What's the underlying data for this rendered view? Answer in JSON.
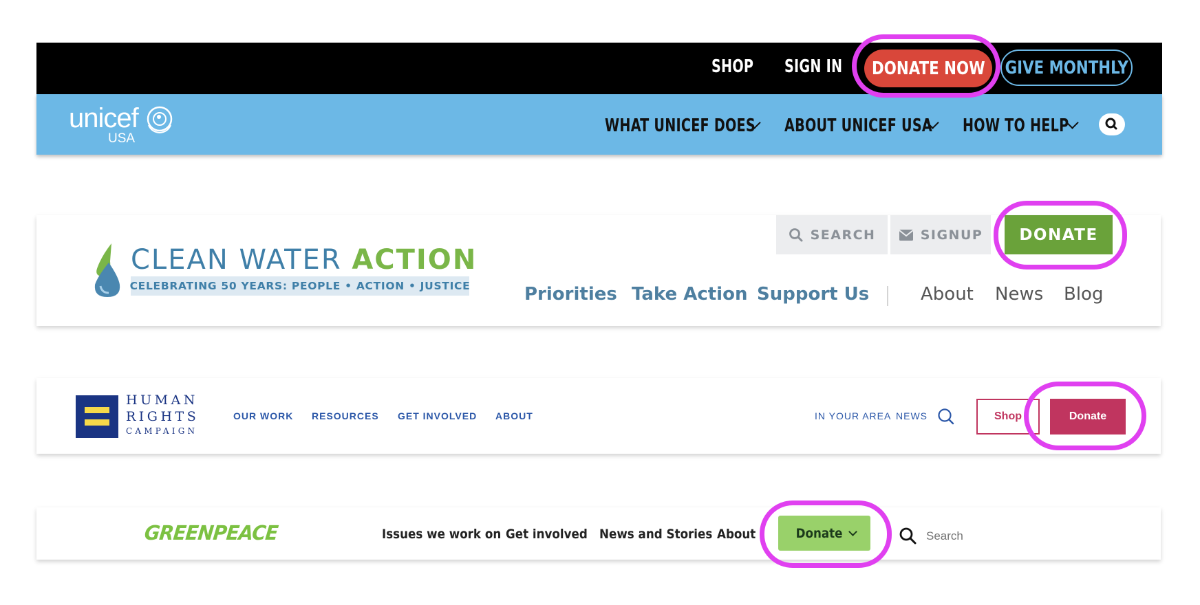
{
  "unicef": {
    "top_links": [
      "SHOP",
      "SIGN IN"
    ],
    "donate_now": "DONATE NOW",
    "give_monthly": "GIVE MONTHLY",
    "logo_text": "unicef",
    "logo_sub": "USA",
    "nav": [
      "WHAT UNICEF DOES",
      "ABOUT UNICEF USA",
      "HOW TO HELP"
    ],
    "colors": {
      "top_bar": "#000000",
      "nav_bar": "#6cb8e6",
      "donate": "#d9473a",
      "give_monthly": "#6cb8e6"
    }
  },
  "clean_water": {
    "logo_main": "CLEAN WATER",
    "logo_accent": "ACTION",
    "tagline": "CELEBRATING 50 YEARS: PEOPLE • ACTION • JUSTICE",
    "search": "SEARCH",
    "signup": "SIGNUP",
    "donate": "DONATE",
    "nav_primary": [
      "Priorities",
      "Take Action",
      "Support Us"
    ],
    "nav_secondary": [
      "About",
      "News",
      "Blog"
    ],
    "colors": {
      "donate": "#6aa23a",
      "primary": "#4e7fa0"
    }
  },
  "hrc": {
    "logo_lines": [
      "HUMAN",
      "RIGHTS",
      "CAMPAIGN"
    ],
    "nav": [
      "OUR WORK",
      "RESOURCES",
      "GET INVOLVED",
      "ABOUT"
    ],
    "utility": [
      "IN YOUR AREA",
      "NEWS"
    ],
    "shop": "Shop",
    "donate": "Donate",
    "colors": {
      "donate": "#c0355f",
      "logo_bg": "#1a3483",
      "logo_bars": "#f6d94a"
    }
  },
  "greenpeace": {
    "logo": "GREENPEACE",
    "nav": [
      "Issues we work on",
      "Get involved",
      "News and Stories",
      "About u"
    ],
    "donate": "Donate",
    "search_placeholder": "Search",
    "colors": {
      "donate": "#99d16a",
      "logo": "#7cc142"
    }
  },
  "highlight_color": "#e040f0"
}
